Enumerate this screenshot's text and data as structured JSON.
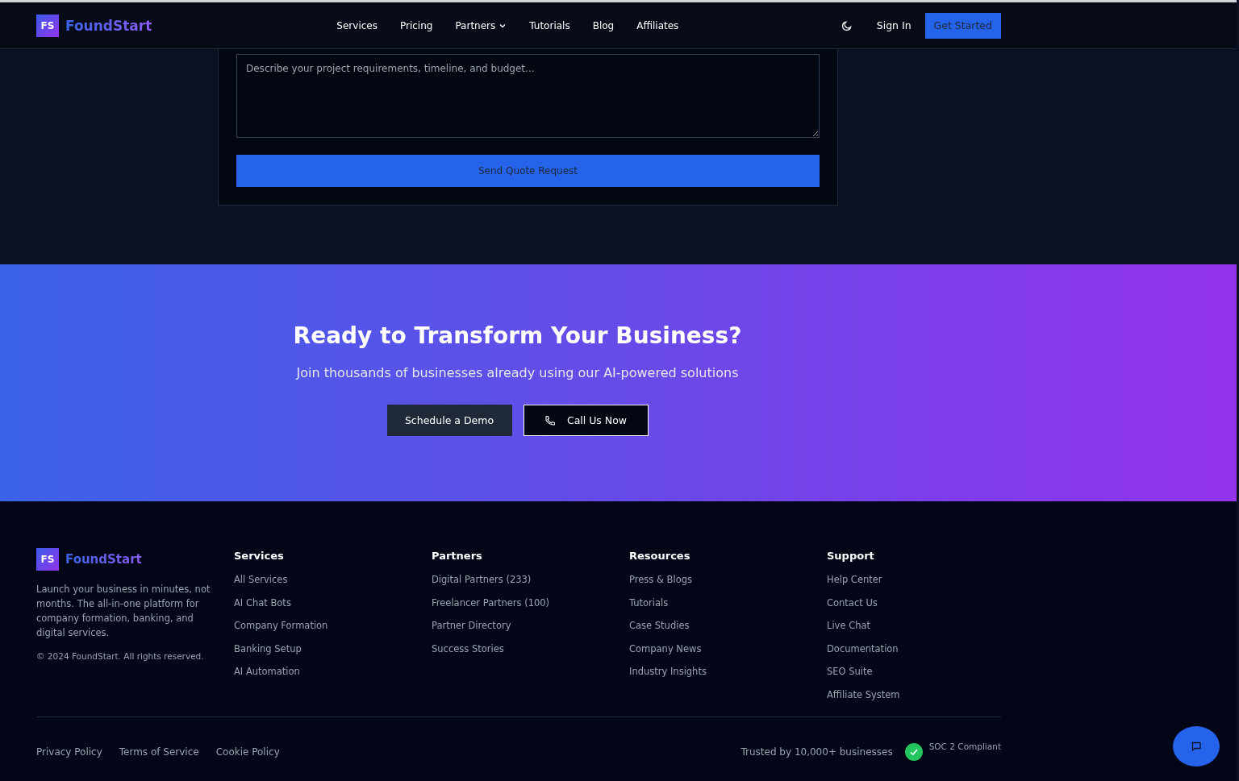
{
  "header": {
    "logo_mark": "FS",
    "brand": "FoundStart",
    "nav": [
      {
        "label": "Services",
        "dropdown": false
      },
      {
        "label": "Pricing",
        "dropdown": false
      },
      {
        "label": "Partners",
        "dropdown": true
      },
      {
        "label": "Tutorials",
        "dropdown": false
      },
      {
        "label": "Blog",
        "dropdown": false
      },
      {
        "label": "Affiliates",
        "dropdown": false
      }
    ],
    "sign_in": "Sign In",
    "get_started": "Get Started"
  },
  "quote_form": {
    "details": {
      "placeholder": "Describe your project requirements, timeline, and budget..."
    },
    "submit": "Send Quote Request"
  },
  "cta": {
    "title": "Ready to Transform Your Business?",
    "subtitle": "Join thousands of businesses already using our AI-powered solutions",
    "buttons": [
      {
        "label": "Schedule a Demo",
        "kind": "filled"
      },
      {
        "label": "Call Us Now",
        "kind": "phone"
      }
    ]
  },
  "footer": {
    "logo_mark": "FS",
    "brand": "FoundStart",
    "description": "Launch your business in minutes, not months. The all-in-one platform for company formation, banking, and digital services.",
    "copyright": "© 2024 FoundStart. All rights reserved.",
    "columns": [
      {
        "title": "Services",
        "links": [
          "All Services",
          "AI Chat Bots",
          "Company Formation",
          "Banking Setup",
          "AI Automation"
        ]
      },
      {
        "title": "Partners",
        "links": [
          "Digital Partners (233)",
          "Freelancer Partners (100)",
          "Partner Directory",
          "Success Stories"
        ]
      },
      {
        "title": "Resources",
        "links": [
          "Press & Blogs",
          "Tutorials",
          "Case Studies",
          "Company News",
          "Industry Insights"
        ]
      },
      {
        "title": "Support",
        "links": [
          "Help Center",
          "Contact Us",
          "Live Chat",
          "Documentation",
          "SEO Suite",
          "Affiliate System"
        ]
      }
    ],
    "legal": [
      "Privacy Policy",
      "Terms of Service",
      "Cookie Policy"
    ],
    "trusted": "Trusted by 10,000+ businesses",
    "badge": "SOC 2 Compliant"
  }
}
